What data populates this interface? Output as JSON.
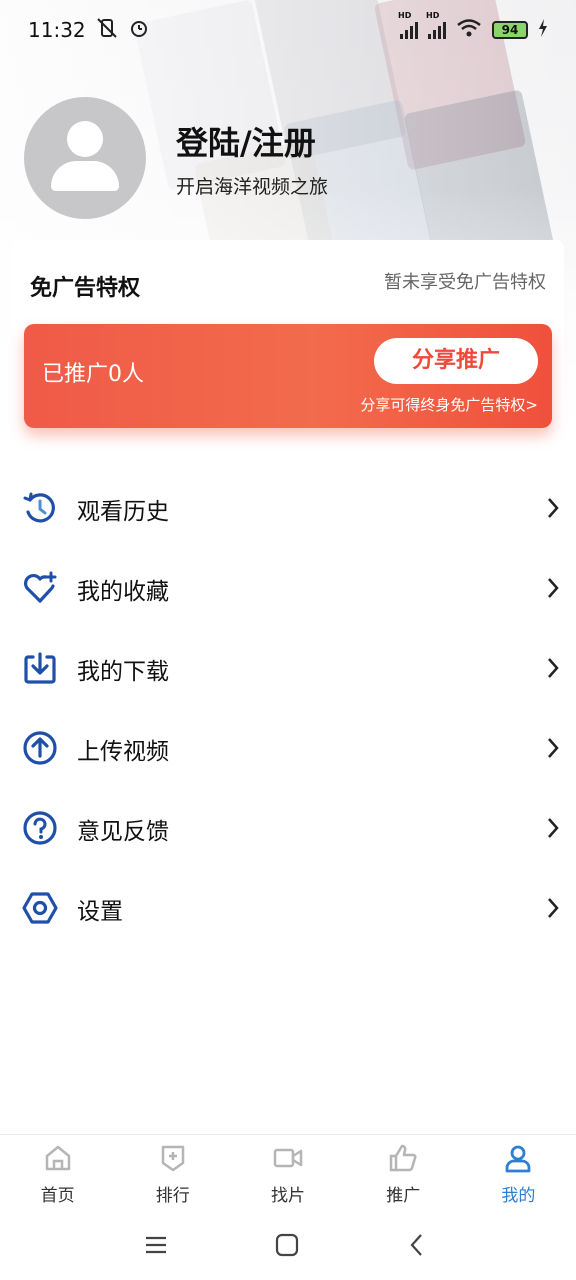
{
  "status_bar": {
    "time": "11:32",
    "battery": "94",
    "hd_label": "HD"
  },
  "profile": {
    "title": "登陆/注册",
    "subtitle": "开启海洋视频之旅"
  },
  "privilege": {
    "title": "免广告特权",
    "status": "暂未享受免广告特权",
    "promo_count": "已推广0人",
    "share_button": "分享推广",
    "promo_note": "分享可得终身免广告特权>"
  },
  "menu": [
    {
      "label": "观看历史",
      "icon": "history-icon"
    },
    {
      "label": "我的收藏",
      "icon": "heart-plus-icon"
    },
    {
      "label": "我的下载",
      "icon": "download-icon"
    },
    {
      "label": "上传视频",
      "icon": "upload-icon"
    },
    {
      "label": "意见反馈",
      "icon": "question-icon"
    },
    {
      "label": "设置",
      "icon": "settings-hex-icon"
    }
  ],
  "bottom_nav": [
    {
      "label": "首页",
      "icon": "home-icon",
      "active": false
    },
    {
      "label": "排行",
      "icon": "ranking-icon",
      "active": false
    },
    {
      "label": "找片",
      "icon": "video-camera-icon",
      "active": false
    },
    {
      "label": "推广",
      "icon": "thumbs-up-icon",
      "active": false
    },
    {
      "label": "我的",
      "icon": "user-icon",
      "active": true
    }
  ],
  "colors": {
    "accent_blue": "#2f7fd0",
    "icon_blue": "#1f4fa8",
    "promo_red": "#f05a48"
  }
}
